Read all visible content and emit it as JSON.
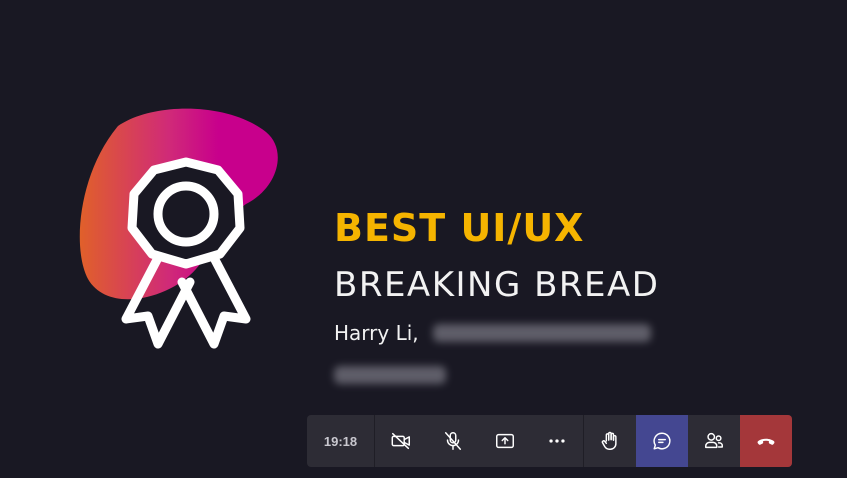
{
  "slide": {
    "award_title": "BEST UI/UX",
    "project_name": "BREAKING BREAD",
    "presenter": "Harry Li,"
  },
  "call_bar": {
    "timer": "19:18",
    "buttons": [
      {
        "name": "camera-off",
        "icon": "camera-off-icon"
      },
      {
        "name": "mic-muted",
        "icon": "mic-off-icon"
      },
      {
        "name": "share-screen",
        "icon": "share-screen-icon"
      },
      {
        "name": "more-actions",
        "icon": "ellipsis-icon"
      },
      {
        "name": "raise-hand",
        "icon": "hand-icon"
      },
      {
        "name": "chat",
        "icon": "chat-icon",
        "active": true
      },
      {
        "name": "participants",
        "icon": "people-icon"
      },
      {
        "name": "leave-call",
        "icon": "hang-up-icon"
      }
    ]
  },
  "colors": {
    "background": "#191823",
    "award_title": "#f5b400",
    "toolbar": "#2d2c35",
    "active_button": "#444791",
    "leave_button": "#a4373a",
    "blob_start": "#e0602a",
    "blob_end": "#c8008c"
  }
}
